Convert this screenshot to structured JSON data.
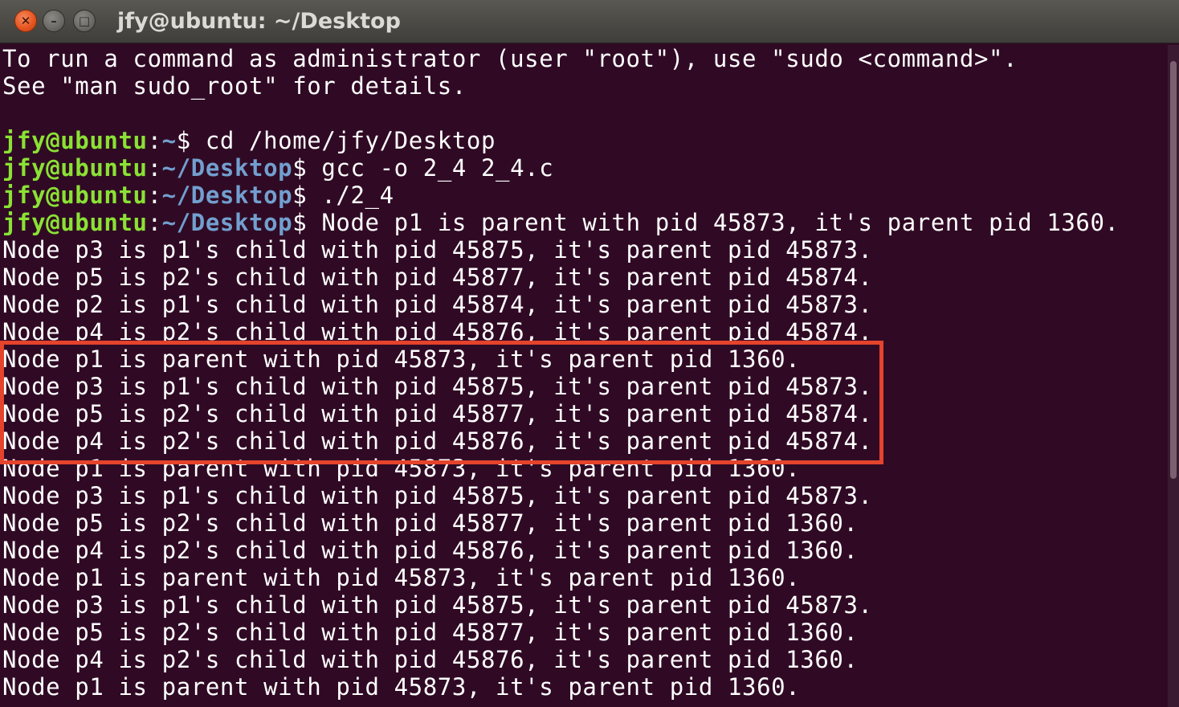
{
  "window": {
    "title": "jfy@ubuntu: ~/Desktop",
    "close_glyph": "✕",
    "minimize_glyph": "–",
    "maximize_glyph": "□"
  },
  "colors": {
    "background": "#300a24",
    "prompt_user": "#8ae234",
    "prompt_path": "#729fcf",
    "text": "#ffffff",
    "highlight_border": "#e4432c"
  },
  "terminal": {
    "motd": [
      "To run a command as administrator (user \"root\"), use \"sudo <command>\".",
      "See \"man sudo_root\" for details."
    ],
    "commands": [
      {
        "user": "jfy@ubuntu",
        "sep": ":",
        "path": "~",
        "dollar": "$",
        "text": " cd /home/jfy/Desktop"
      },
      {
        "user": "jfy@ubuntu",
        "sep": ":",
        "path": "~/Desktop",
        "dollar": "$",
        "text": " gcc -o 2_4 2_4.c"
      },
      {
        "user": "jfy@ubuntu",
        "sep": ":",
        "path": "~/Desktop",
        "dollar": "$",
        "text": " ./2_4"
      },
      {
        "user": "jfy@ubuntu",
        "sep": ":",
        "path": "~/Desktop",
        "dollar": "$",
        "text": " Node p1 is parent with pid 45873, it's parent pid 1360."
      }
    ],
    "output": [
      "Node p3 is p1's child with pid 45875, it's parent pid 45873.",
      "Node p5 is p2's child with pid 45877, it's parent pid 45874.",
      "Node p2 is p1's child with pid 45874, it's parent pid 45873.",
      "Node p4 is p2's child with pid 45876, it's parent pid 45874.",
      "Node p1 is parent with pid 45873, it's parent pid 1360.",
      "Node p3 is p1's child with pid 45875, it's parent pid 45873.",
      "Node p5 is p2's child with pid 45877, it's parent pid 45874.",
      "Node p4 is p2's child with pid 45876, it's parent pid 45874.",
      "Node p1 is parent with pid 45873, it's parent pid 1360.",
      "Node p3 is p1's child with pid 45875, it's parent pid 45873.",
      "Node p5 is p2's child with pid 45877, it's parent pid 1360.",
      "Node p4 is p2's child with pid 45876, it's parent pid 1360.",
      "Node p1 is parent with pid 45873, it's parent pid 1360.",
      "Node p3 is p1's child with pid 45875, it's parent pid 45873.",
      "Node p5 is p2's child with pid 45877, it's parent pid 1360.",
      "Node p4 is p2's child with pid 45876, it's parent pid 1360.",
      "Node p1 is parent with pid 45873, it's parent pid 1360."
    ]
  }
}
